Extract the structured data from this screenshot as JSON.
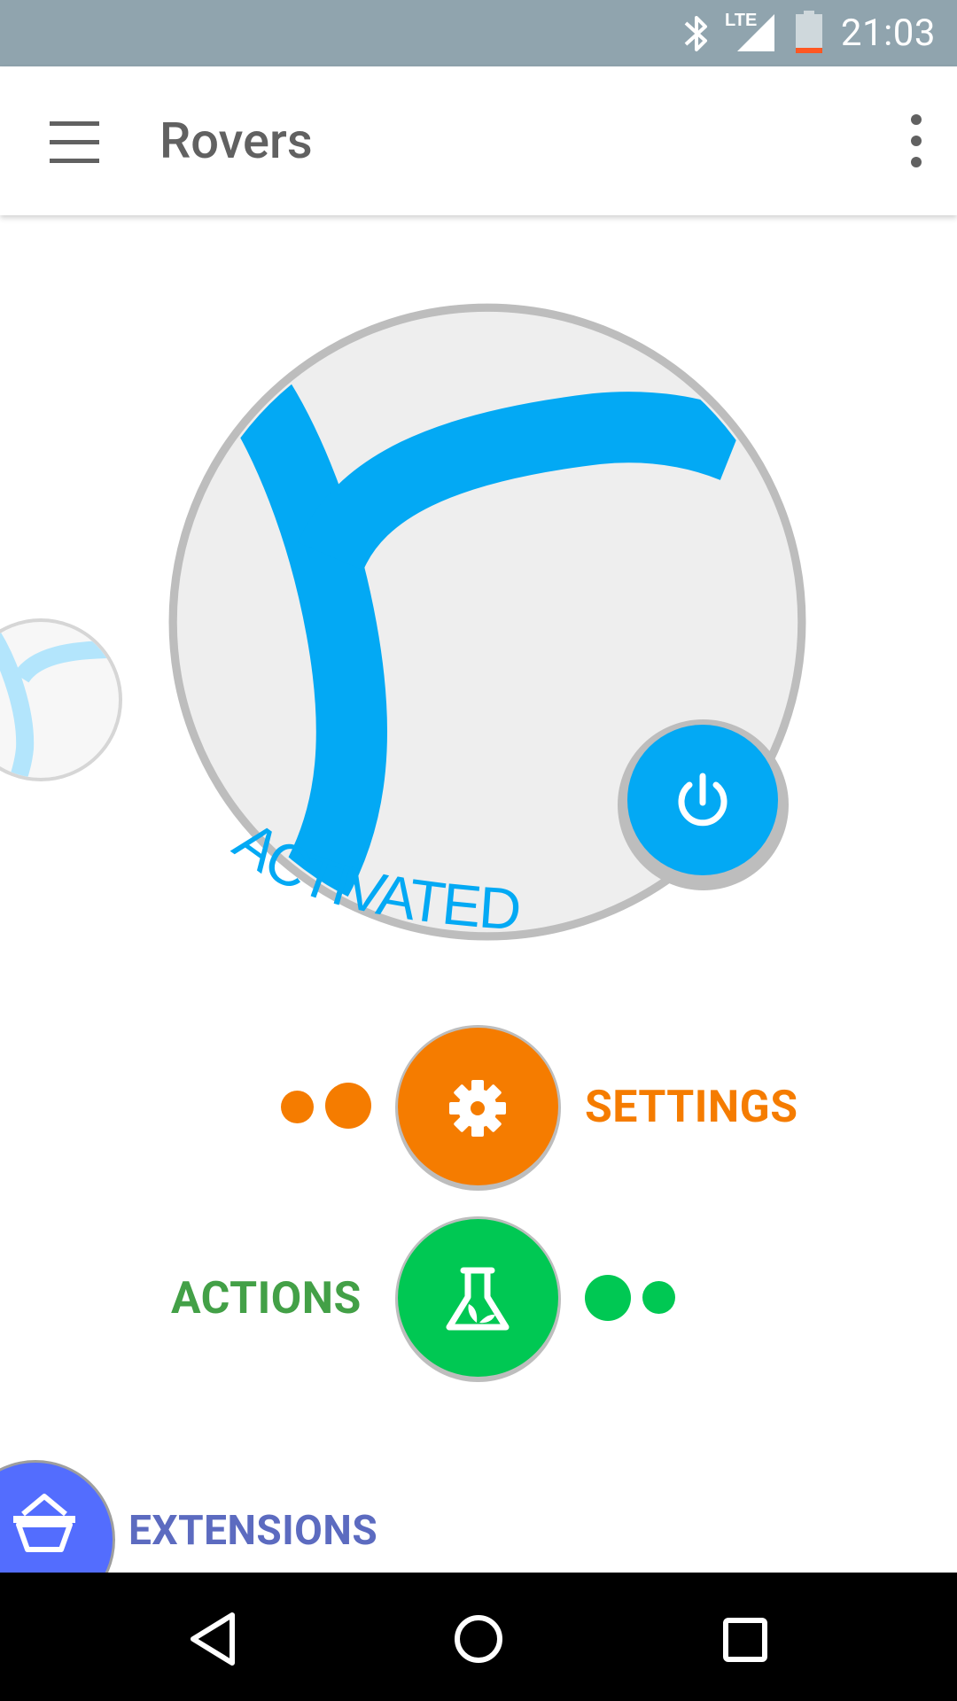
{
  "status_bar": {
    "time": "21:03",
    "network_label": "LTE",
    "icons": [
      "bluetooth-icon",
      "lte-signal-icon",
      "battery-low-icon"
    ],
    "background": "#90a4ae"
  },
  "app_bar": {
    "title": "Rovers",
    "menu_icon": "hamburger-menu-icon",
    "overflow_icon": "more-vert-icon"
  },
  "rover": {
    "status": "ACTIVATED",
    "power_icon": "power-icon",
    "accent_color": "#03a9f4"
  },
  "actions": {
    "settings_label": "SETTINGS",
    "settings_icon": "gear-icon",
    "settings_color": "#f57c00",
    "actions_label": "ACTIONS",
    "actions_icon": "flask-icon",
    "actions_color": "#00c853",
    "extensions_label": "EXTENSIONS",
    "extensions_icon": "basket-icon",
    "extensions_color": "#536dfe"
  },
  "nav_bar": {
    "icons": [
      "back-icon",
      "home-icon",
      "recents-icon"
    ]
  }
}
